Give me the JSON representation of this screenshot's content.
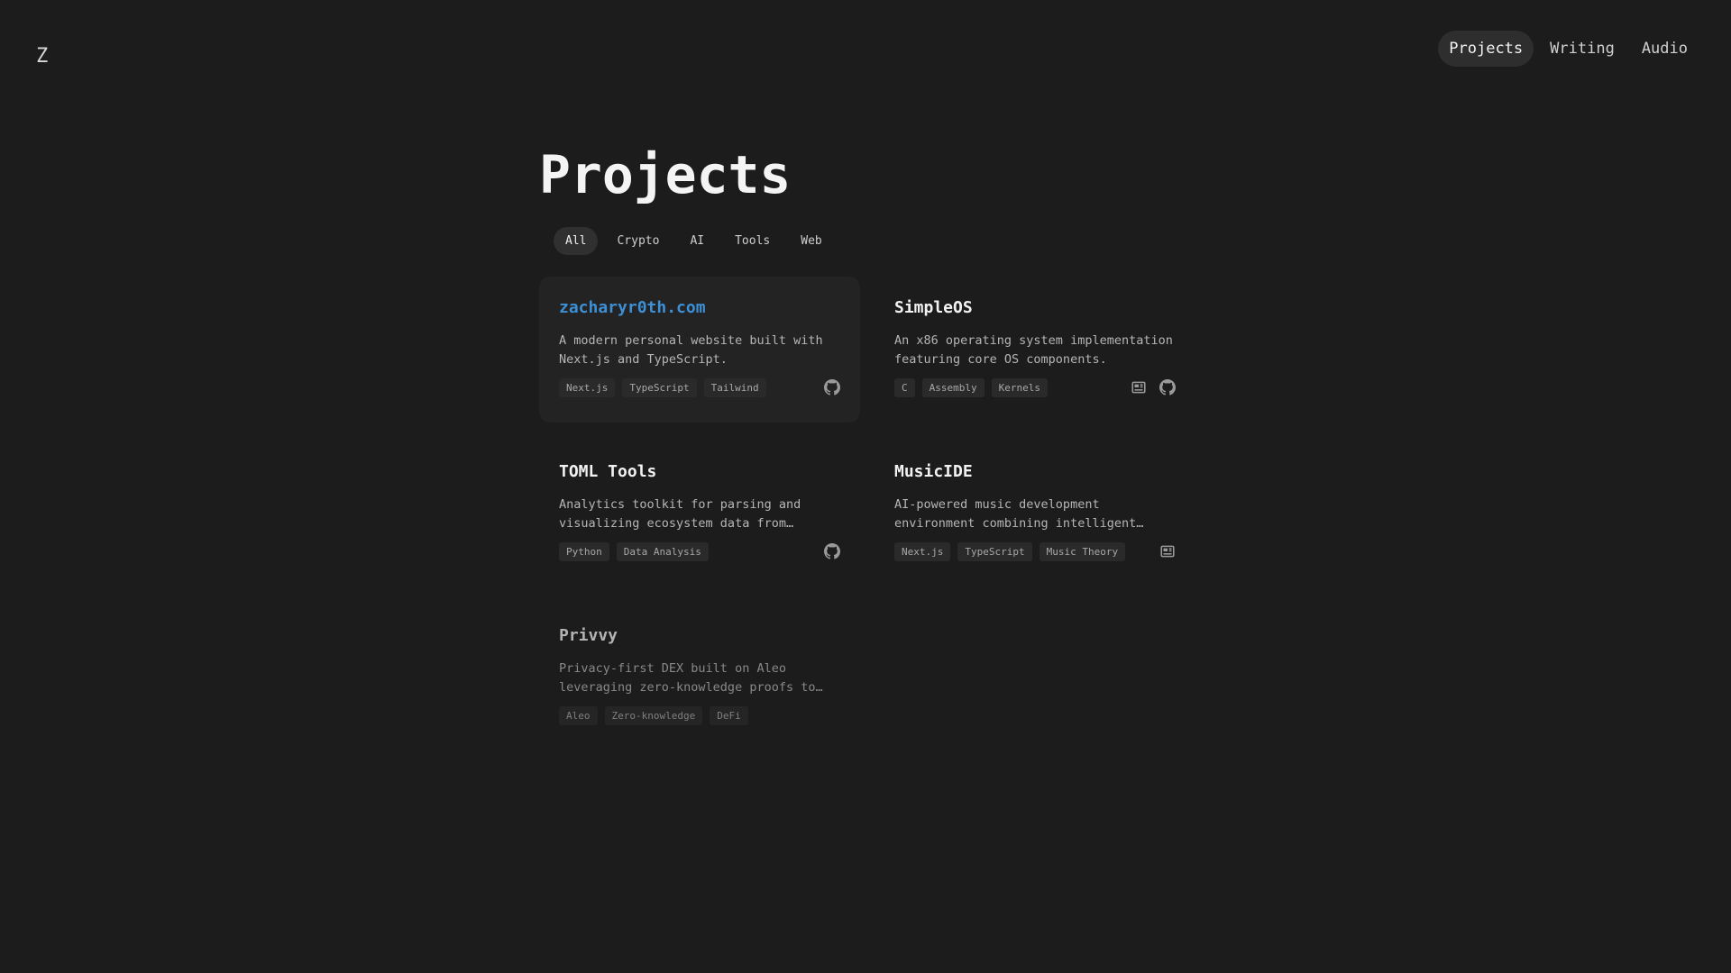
{
  "brand": {
    "logo": "Z"
  },
  "nav": {
    "items": [
      {
        "label": "Projects",
        "active": true
      },
      {
        "label": "Writing",
        "active": false
      },
      {
        "label": "Audio",
        "active": false
      }
    ]
  },
  "page": {
    "title": "Projects"
  },
  "filters": [
    {
      "label": "All",
      "active": true
    },
    {
      "label": "Crypto",
      "active": false
    },
    {
      "label": "AI",
      "active": false
    },
    {
      "label": "Tools",
      "active": false
    },
    {
      "label": "Web",
      "active": false
    }
  ],
  "projects": [
    {
      "title": "zacharyr0th.com",
      "description": "A modern personal website built with Next.js and TypeScript.",
      "tags": [
        "Next.js",
        "TypeScript",
        "Tailwind"
      ],
      "icons": [
        "github-icon"
      ]
    },
    {
      "title": "SimpleOS",
      "description": "An x86 operating system implementation featuring core OS components.",
      "tags": [
        "C",
        "Assembly",
        "Kernels"
      ],
      "icons": [
        "article-icon",
        "github-icon"
      ]
    },
    {
      "title": "TOML Tools",
      "description": "Analytics toolkit for parsing and visualizing ecosystem data from…",
      "tags": [
        "Python",
        "Data Analysis"
      ],
      "icons": [
        "github-icon"
      ]
    },
    {
      "title": "MusicIDE",
      "description": "AI-powered music development environment combining intelligent…",
      "tags": [
        "Next.js",
        "TypeScript",
        "Music Theory"
      ],
      "icons": [
        "article-icon"
      ]
    },
    {
      "title": "Privvy",
      "description": "Privacy-first DEX built on Aleo leveraging zero-knowledge proofs to…",
      "tags": [
        "Aleo",
        "Zero-knowledge",
        "DeFi"
      ],
      "icons": []
    }
  ],
  "colors": {
    "background": "#1c1c1c",
    "link": "#3d8fd6",
    "active_pill": "#2e2e2e"
  }
}
